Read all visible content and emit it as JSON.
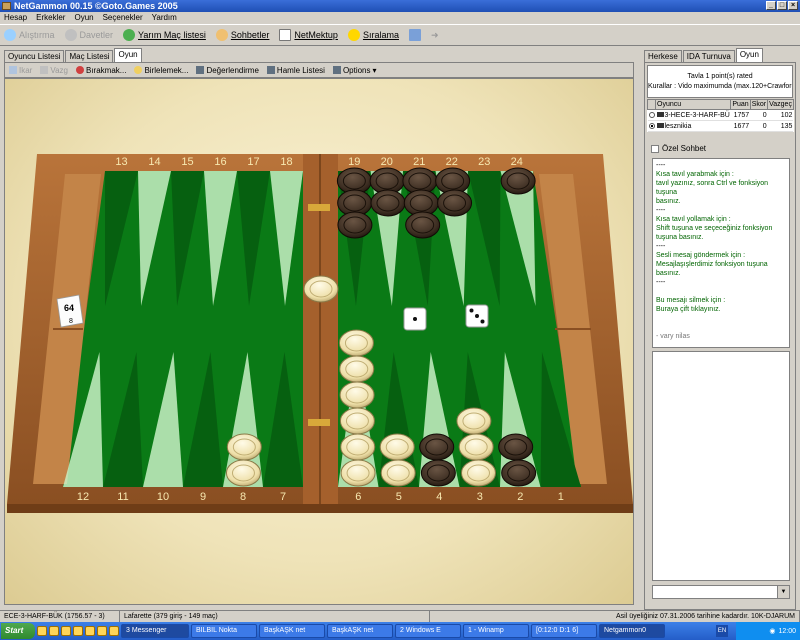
{
  "window": {
    "title": "NetGammon 00.15 ©Goto.Games 2005"
  },
  "menu": [
    "Hesap",
    "Erkekler",
    "Oyun",
    "Seçenekler",
    "Yardım"
  ],
  "toolbar": [
    {
      "label": "Alıştırma",
      "disabled": true,
      "icon": "practice-icon",
      "color": "#9ad0ff"
    },
    {
      "label": "Davetler",
      "disabled": true,
      "icon": "invites-icon",
      "color": "#c0c0c0"
    },
    {
      "label": "Yarım Maç listesi",
      "disabled": false,
      "icon": "globe-icon",
      "color": "#4caf50"
    },
    {
      "label": "Sohbetler",
      "disabled": false,
      "icon": "chat-person-icon",
      "color": "#f0c070"
    },
    {
      "label": "NetMektup",
      "disabled": false,
      "icon": "mail-icon",
      "color": "#ffffff"
    },
    {
      "label": "Sıralama",
      "disabled": false,
      "icon": "ranking-icon",
      "color": "#ffd700"
    }
  ],
  "left_tabs": [
    {
      "label": "Oyuncu Listesi",
      "active": false
    },
    {
      "label": "Maç Listesi",
      "active": false
    },
    {
      "label": "Oyun",
      "active": true
    }
  ],
  "sub_toolbar": [
    {
      "label": "Ikar",
      "disabled": true,
      "color": "#b0c4de"
    },
    {
      "label": "Vazg",
      "disabled": true,
      "color": "#c0c0c0"
    },
    {
      "label": "Bırakmak...",
      "disabled": false,
      "color": "#d04040"
    },
    {
      "label": "Birlelemek...",
      "disabled": false,
      "color": "#f0d060"
    },
    {
      "label": "Değerlendirme",
      "disabled": false,
      "color": "#607080"
    },
    {
      "label": "Hamle Listesi",
      "disabled": false,
      "color": "#607080"
    },
    {
      "label": "Options",
      "disabled": false,
      "color": "#607080"
    }
  ],
  "right_tabs": [
    {
      "label": "Herkese",
      "active": false
    },
    {
      "label": "IDA Turnuva",
      "active": false
    },
    {
      "label": "Oyun",
      "active": true
    }
  ],
  "game_info": {
    "line1": "Tavla 1 point(s) rated",
    "line2": "Kurallar : Vido maximumda (max.120+Crawford"
  },
  "players_table": {
    "headers": [
      "Oyuncu",
      "Puan",
      "Skor",
      "Vazgeç"
    ],
    "rows": [
      {
        "name": "3-HECE-3-HARF-BÜ",
        "rating": "1757",
        "score": "0",
        "resign": "102",
        "active": false
      },
      {
        "name": "lesznikia",
        "rating": "1677",
        "score": "0",
        "resign": "135",
        "active": true
      }
    ]
  },
  "private_chat_label": "Özel Sohbet",
  "chat_lines": [
    {
      "t": "----",
      "cls": "dash"
    },
    {
      "t": "Kısa tavıl yarabmak için :",
      "cls": ""
    },
    {
      "t": "tavıl yazınız, sonra Ctrl ve fonksiyon tuşuna",
      "cls": ""
    },
    {
      "t": "basınız.",
      "cls": ""
    },
    {
      "t": "----",
      "cls": "dash"
    },
    {
      "t": "Kısa tavıl yollamak için :",
      "cls": ""
    },
    {
      "t": "Shift tuşuna ve seçeceğiniz fonksiyon",
      "cls": ""
    },
    {
      "t": "tuşuna basınız.",
      "cls": ""
    },
    {
      "t": "----",
      "cls": "dash"
    },
    {
      "t": "Sesli mesaj göndermek için :",
      "cls": ""
    },
    {
      "t": "Mesajlaşışlerdimiz fonksiyon tuşuna",
      "cls": ""
    },
    {
      "t": "basınız.",
      "cls": ""
    },
    {
      "t": "----",
      "cls": "dash"
    },
    {
      "t": "",
      "cls": ""
    },
    {
      "t": "Bu mesajı silmek için :",
      "cls": ""
    },
    {
      "t": "Buraya çift tıklayınız.",
      "cls": ""
    },
    {
      "t": "",
      "cls": ""
    },
    {
      "t": "",
      "cls": ""
    },
    {
      "t": "- vary nilas",
      "cls": "foot"
    }
  ],
  "board": {
    "top_labels": [
      "13",
      "14",
      "15",
      "16",
      "17",
      "18",
      "19",
      "20",
      "21",
      "22",
      "23",
      "24"
    ],
    "bottom_labels": [
      "12",
      "11",
      "10",
      "9",
      "8",
      "7",
      "6",
      "5",
      "4",
      "3",
      "2",
      "1"
    ],
    "doubling_cube": {
      "value": "64",
      "lower": "8"
    },
    "dice": [
      1,
      3
    ],
    "points": {
      "19": {
        "color": "dark",
        "count": 3
      },
      "20": {
        "color": "dark",
        "count": 2
      },
      "21": {
        "color": "dark",
        "count": 3
      },
      "22": {
        "color": "dark",
        "count": 2
      },
      "24": {
        "color": "dark",
        "count": 1
      },
      "8": {
        "color": "light",
        "count": 2
      },
      "6": {
        "color": "light",
        "count": 6
      },
      "5": {
        "color": "light",
        "count": 2
      },
      "4": {
        "color": "dark",
        "count": 2
      },
      "3": {
        "color": "light",
        "count": 3
      },
      "2": {
        "color": "dark",
        "count": 2
      }
    },
    "bar_light": 1
  },
  "status": [
    "ECE-3-HARF-BÜK (1756.57 - 3)",
    "Lafarette (379 giriş - 149 maç)",
    "Asil üyeliğiniz 07.31.2006 tarihine kadardır. 10K-DJARUM"
  ],
  "taskbar": {
    "start": "Start",
    "buttons": [
      {
        "label": "3 Messenger",
        "active": true
      },
      {
        "label": "BILBIL Nokta",
        "active": false
      },
      {
        "label": "BaşkAŞK net",
        "active": false
      },
      {
        "label": "BaşkAŞK net",
        "active": false
      },
      {
        "label": "2 Windows E",
        "active": false
      },
      {
        "label": "1 - Winamp",
        "active": false
      },
      {
        "label": "[0:12:0 D:1 6]",
        "active": false
      },
      {
        "label": "Netgammon0",
        "active": true
      }
    ],
    "lang": "EN",
    "clock": "12:00"
  }
}
